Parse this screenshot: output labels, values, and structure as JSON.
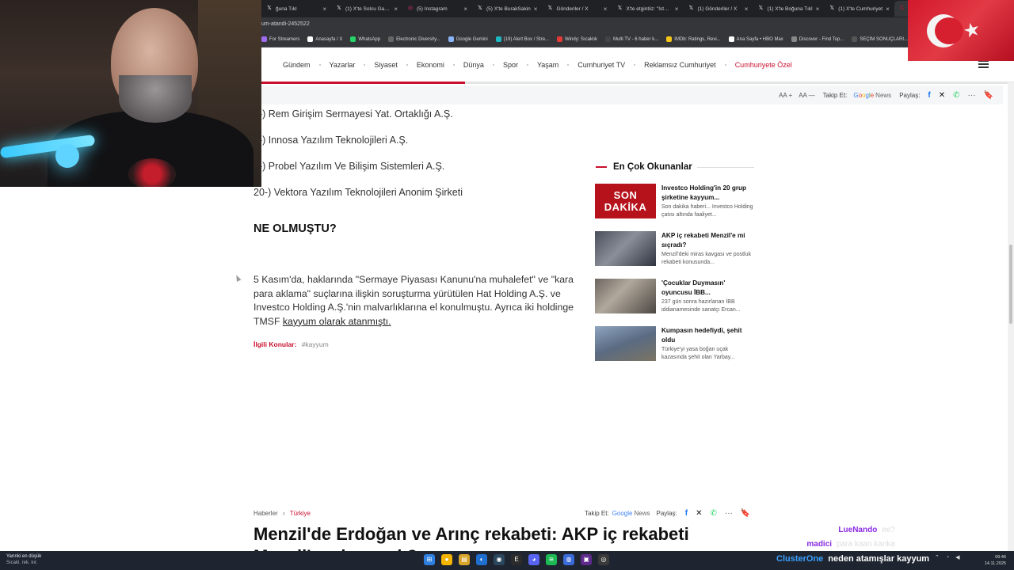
{
  "browser": {
    "tabs": [
      {
        "label": "ğuna Tıkl",
        "icon": "x"
      },
      {
        "label": "(1) X'te Solcu Gazet",
        "icon": "x"
      },
      {
        "label": "(5) Instagram",
        "icon": "instagram"
      },
      {
        "label": "(5) X'te BurakSakin",
        "icon": "x"
      },
      {
        "label": "Gönderiler / X",
        "icon": "x"
      },
      {
        "label": "X'te etgintiiz: \"İstanb",
        "icon": "x"
      },
      {
        "label": "(1) Gönderiler / X",
        "icon": "x"
      },
      {
        "label": "(1) X'te Boğuna Tıkl",
        "icon": "x"
      },
      {
        "label": "(1) X'te Cumhuriyet",
        "icon": "x"
      },
      {
        "label": "Son dakika... Inves",
        "icon": "cumhuriyet",
        "active": true
      }
    ],
    "url": "um-atandi-2452522",
    "bookmarks": [
      "For Streamers",
      "Anasayfa / X",
      "WhatsApp",
      "Electronic Diversity...",
      "Google Gemini",
      "(19) Alert Box / Stre...",
      "Windy: Sıcaklık",
      "Multi TV - 6 haber k...",
      "IMDb: Ratings, Revi...",
      "Ana Sayfa • HBO Max",
      "Discover - Find Top...",
      "SEÇİM SONUÇLARI...",
      "Ch"
    ]
  },
  "site": {
    "nav": [
      "Gündem",
      "Yazarlar",
      "Siyaset",
      "Ekonomi",
      "Dünya",
      "Spor",
      "Yaşam",
      "Cumhuriyet TV",
      "Reklamsız Cumhuriyet"
    ],
    "nav_special": "Cumhuriyete Özel",
    "read_progress": 0.27,
    "tools": {
      "font_small": "AA +",
      "font_large": "AA —",
      "follow": "Takip Et:",
      "gnews_g": "G",
      "gnews_o1": "o",
      "gnews_o2": "o",
      "gnews_g2": "g",
      "gnews_l": "l",
      "gnews_e": "e",
      "news": "News",
      "share": "Paylaş:",
      "more": "···"
    }
  },
  "article": {
    "list": [
      "7-) Rem Girişim Sermayesi Yat. Ortaklığı A.Ş.",
      "8-) Innosa Yazılım Teknolojileri A.Ş.",
      "9-) Probel Yazılım Ve Bilişim Sistemleri A.Ş.",
      "20-) Vektora Yazılım Teknolojileri Anonim Şirketi"
    ],
    "section_heading": "NE OLMUŞTU?",
    "paragraph": "5 Kasım'da, haklarında \"Sermaye Piyasası Kanunu'na muhalefet\" ve \"kara para aklama\" suçlarına ilişkin soruşturma yürütülen Hat Holding A.Ş. ve Investco Holding A.Ş.'nin malvarlıklarına el konulmuştu. Ayrıca iki holdinge TMSF ",
    "paragraph_link": "kayyum olarak atanmıştı.",
    "related_label": "İlgili Konular:",
    "related_tag": "#kayyum"
  },
  "sidebar": {
    "heading": "En Çok Okunanlar",
    "items": [
      {
        "thumb_text_1": "SON",
        "thumb_text_2": "DAKİKA",
        "title": "Investco Holding'in 20 grup şirketine kayyum...",
        "desc": "Son dakika haberi... Investco Holding çatısı altında faaliyet..."
      },
      {
        "title": "AKP iç rekabeti Menzil'e mi sıçradı?",
        "desc": "Menzil'deki miras kavgası ve postluk rekabeti konusunda..."
      },
      {
        "title": "'Çocuklar Duymasın' oyuncusu İBB...",
        "desc": "237 gün sonra hazırlanan İBB iddianamesinde sanatçı Ercan..."
      },
      {
        "title": "Kumpasın hedefiydi, şehit oldu",
        "desc": "Türkiye'yi yasa boğan uçak kazasında şehit olan Yarbay..."
      }
    ]
  },
  "next_article": {
    "crumb_home": "Haberler",
    "crumb_section": "Türkiye",
    "follow": "Takip Et:",
    "gnews": "Google",
    "news": "News",
    "share": "Paylaş:",
    "more": "···",
    "title": "Menzil'de Erdoğan ve Arınç rekabeti: AKP iç rekabeti Menzil'e mi sıçradı?"
  },
  "overlay": {
    "chat": [
      {
        "user": "LueNando",
        "msg": "ee?"
      },
      {
        "user": "madici",
        "msg": "para kaan kanka"
      }
    ],
    "ticker_source": "ClusterOne",
    "ticker_msg": "neden atamışlar kayyum"
  },
  "taskbar": {
    "weather_1": "Yarınki en düşük",
    "weather_2": "Sıcakl. rek. kır.",
    "time": "09:46",
    "date": "14.11.2025"
  }
}
